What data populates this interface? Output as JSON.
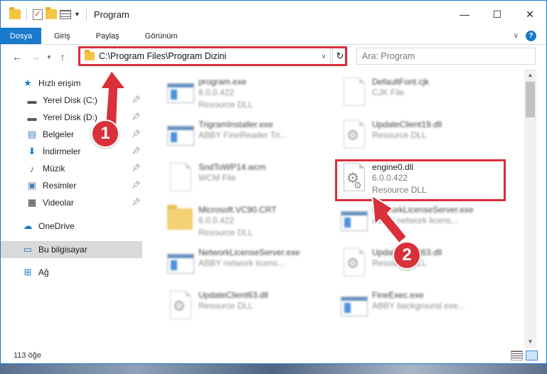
{
  "window": {
    "title": "Program",
    "controls": {
      "minimize": "—",
      "maximize": "☐",
      "close": "✕"
    }
  },
  "ribbon": {
    "file_tab": "Dosya",
    "tabs": [
      "Giriş",
      "Paylaş",
      "Görünüm"
    ],
    "help": "?"
  },
  "navigation": {
    "back": "←",
    "forward": "→",
    "up": "↑",
    "address": "C:\\Program Files\\Program Dizini",
    "refresh": "↻",
    "search_placeholder": "Ara: Program"
  },
  "sidebar": {
    "items": [
      {
        "label": "Hızlı erişim",
        "icon": "star-icon"
      },
      {
        "label": "Yerel Disk (C:)",
        "icon": "drive-icon",
        "pinned": true
      },
      {
        "label": "Yerel Disk (D:)",
        "icon": "drive-icon",
        "pinned": true
      },
      {
        "label": "Belgeler",
        "icon": "documents-icon",
        "pinned": true
      },
      {
        "label": "İndirmeler",
        "icon": "download-icon",
        "pinned": true
      },
      {
        "label": "Müzik",
        "icon": "music-icon",
        "pinned": true
      },
      {
        "label": "Resimler",
        "icon": "pictures-icon",
        "pinned": true
      },
      {
        "label": "Videolar",
        "icon": "videos-icon",
        "pinned": true
      },
      {
        "label": "OneDrive",
        "icon": "cloud-icon"
      },
      {
        "label": "Bu bilgisayar",
        "icon": "computer-icon",
        "selected": true
      },
      {
        "label": "Ağ",
        "icon": "network-icon"
      }
    ]
  },
  "files": [
    {
      "name": "program.exe",
      "line2": "6.0.0.422",
      "line3": "Resource DLL"
    },
    {
      "name": "DefaultFont.cjk",
      "line2": "CJK File"
    },
    {
      "name": "TrigramInstaller.exe",
      "line2": "ABBY FineReader Tri..."
    },
    {
      "name": "UpdateClient19.dll",
      "line2": "Resource DLL"
    },
    {
      "name": "SndToWP14.wcm",
      "line2": "WCM File"
    },
    {
      "name": "engine0.dll",
      "line2": "6.0.0.422",
      "line3": "Resource DLL"
    },
    {
      "name": "Microsoft.VC90.CRT",
      "line2": "6.0.0.422",
      "line3": "Resource DLL"
    },
    {
      "name": "NetworkLicenseServer.exe",
      "line2": "ABBY network licens..."
    },
    {
      "name": "NetworkLicenseServer.exe",
      "line2": "ABBY network licens..."
    },
    {
      "name": "UpdateClient63.dll",
      "line2": "Resource DLL"
    },
    {
      "name": "UpdateClient63.dll",
      "line2": "Resource DLL"
    },
    {
      "name": "FineExec.exe",
      "line2": "ABBY background exe..."
    }
  ],
  "status": {
    "item_count": "113 öğe"
  },
  "callouts": {
    "step1": "1",
    "step2": "2"
  },
  "colors": {
    "accent": "#1979ca",
    "highlight": "#d9303a"
  }
}
